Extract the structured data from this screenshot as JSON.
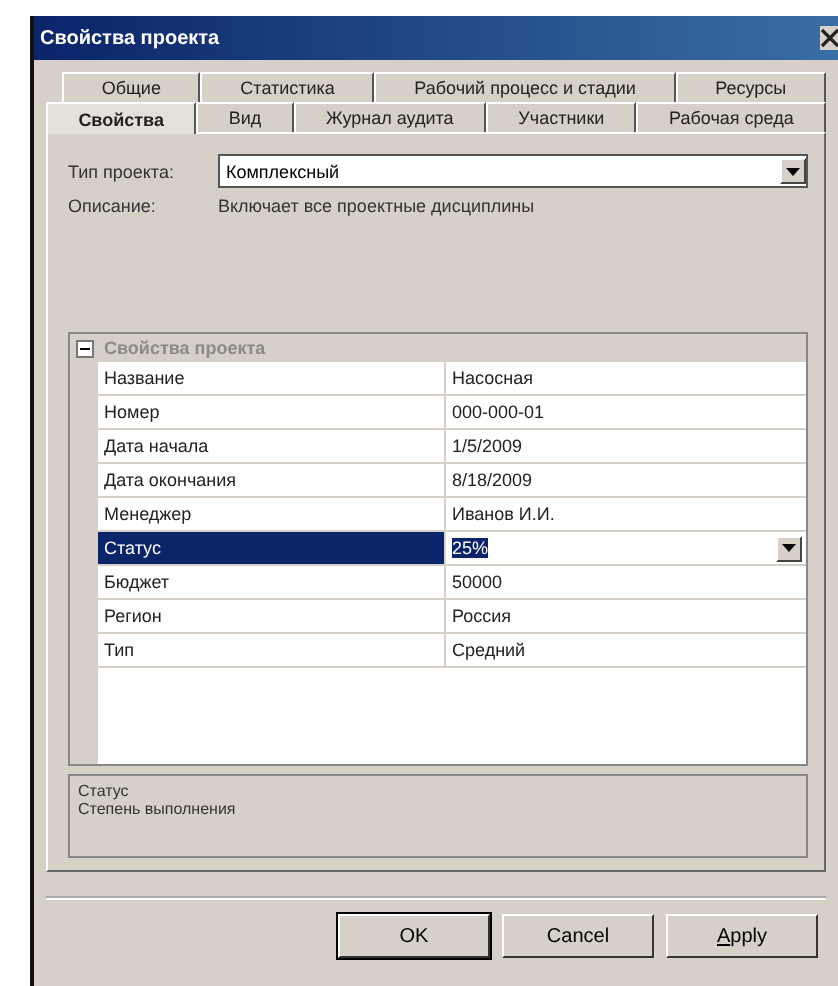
{
  "window": {
    "title": "Свойства проекта"
  },
  "tab_rows": [
    [
      {
        "label": "Общие",
        "selected": false
      },
      {
        "label": "Статистика",
        "selected": false
      },
      {
        "label": "Рабочий процесс и стадии",
        "selected": false
      },
      {
        "label": "Ресурсы",
        "selected": false
      }
    ],
    [
      {
        "label": "Свойства",
        "selected": true
      },
      {
        "label": "Вид",
        "selected": false
      },
      {
        "label": "Журнал аудита",
        "selected": false
      },
      {
        "label": "Участники",
        "selected": false
      },
      {
        "label": "Рабочая среда",
        "selected": false
      }
    ]
  ],
  "project_type": {
    "label": "Тип проекта:",
    "value": "Комплексный"
  },
  "description": {
    "label": "Описание:",
    "value": "Включает все проектные дисциплины"
  },
  "property_grid": {
    "category": "Свойства проекта",
    "expanded": true,
    "rows": [
      {
        "name": "Название",
        "value": "Насосная",
        "selected": false
      },
      {
        "name": "Номер",
        "value": "000-000-01",
        "selected": false
      },
      {
        "name": "Дата начала",
        "value": "1/5/2009",
        "selected": false
      },
      {
        "name": "Дата окончания",
        "value": "8/18/2009",
        "selected": false
      },
      {
        "name": "Менеджер",
        "value": "Иванов И.И.",
        "selected": false
      },
      {
        "name": "Статус",
        "value": "25%",
        "selected": true
      },
      {
        "name": "Бюджет",
        "value": "50000",
        "selected": false
      },
      {
        "name": "Регион",
        "value": "Россия",
        "selected": false
      },
      {
        "name": "Тип",
        "value": "Средний",
        "selected": false
      }
    ]
  },
  "help": {
    "title": "Статус",
    "text": "Степень выполнения"
  },
  "buttons": [
    {
      "label": "OK",
      "default": true,
      "mnemonic": false
    },
    {
      "label": "Cancel",
      "default": false,
      "mnemonic": false
    },
    {
      "label": "Apply",
      "default": false,
      "mnemonic": true
    }
  ]
}
